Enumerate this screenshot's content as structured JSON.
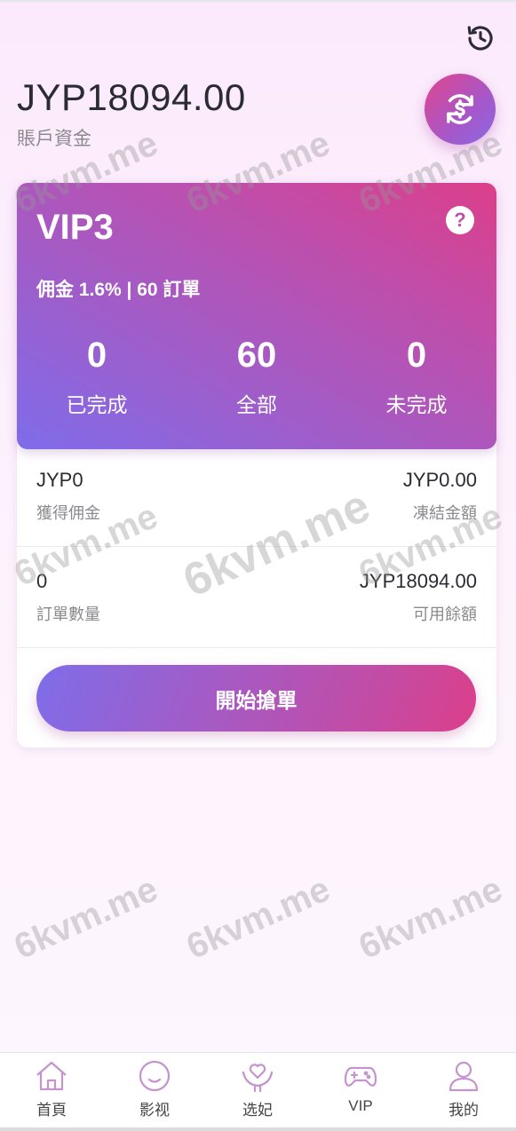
{
  "account": {
    "balance": "JYP18094.00",
    "balance_label": "賬戶資金"
  },
  "icons": {
    "history": "history-clock-icon",
    "exchange": "currency-exchange-icon",
    "help": "question-circle-icon"
  },
  "vip_card": {
    "level": "VIP3",
    "help_glyph": "?",
    "commission_info": "佣金 1.6% | 60 訂單",
    "stats": [
      {
        "value": "0",
        "label": "已完成"
      },
      {
        "value": "60",
        "label": "全部"
      },
      {
        "value": "0",
        "label": "未完成"
      }
    ]
  },
  "details": {
    "rows": [
      {
        "left_value": "JYP0",
        "left_label": "獲得佣金",
        "right_value": "JYP0.00",
        "right_label": "凍結金額"
      },
      {
        "left_value": "0",
        "left_label": "訂單數量",
        "right_value": "JYP18094.00",
        "right_label": "可用餘額"
      }
    ],
    "start_button": "開始搶單"
  },
  "watermark_text": "6kvm.me",
  "tabbar": {
    "items": [
      {
        "label": "首頁",
        "icon": "home-icon"
      },
      {
        "label": "影视",
        "icon": "smile-icon"
      },
      {
        "label": "选妃",
        "icon": "heart-hand-icon"
      },
      {
        "label": "VIP",
        "icon": "gamepad-icon"
      },
      {
        "label": "我的",
        "icon": "user-icon"
      }
    ]
  },
  "colors": {
    "accent_pink": "#dc3f8a",
    "accent_purple": "#7f6cea",
    "tab_icon": "#c593cf"
  }
}
